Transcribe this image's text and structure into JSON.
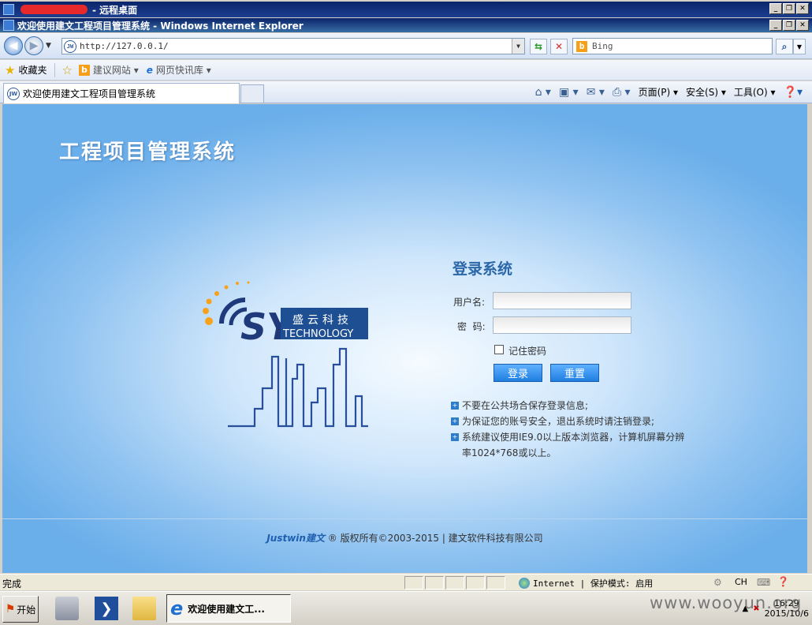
{
  "remote_window": {
    "title": "- 远程桌面"
  },
  "ie_window": {
    "title": "欢迎使用建文工程项目管理系统 - Windows Internet Explorer"
  },
  "address_bar": {
    "url": "http://127.0.0.1/",
    "search_placeholder": "Bing"
  },
  "favorites_bar": {
    "favorites_label": "收藏夹",
    "items": [
      "建议网站 ▾",
      "网页快讯库 ▾"
    ]
  },
  "tab": {
    "label": "欢迎使用建文工程项目管理系统"
  },
  "command_bar": {
    "page": "页面(P) ▾",
    "safety": "安全(S) ▾",
    "tools": "工具(O) ▾"
  },
  "page": {
    "system_title": "工程项目管理系统",
    "logo": {
      "company_cn": "盛云科技",
      "company_en": "TECHNOLOGY",
      "mark": "SY"
    },
    "login": {
      "title": "登录系统",
      "username_label": "用户名:",
      "password_label": "密  码:",
      "remember_label": "记住密码",
      "login_button": "登录",
      "reset_button": "重置"
    },
    "tips": [
      "不要在公共场合保存登录信息;",
      "为保证您的账号安全，退出系统时请注销登录;",
      "系统建议使用IE9.0以上版本浏览器，计算机屏幕分辨",
      "率1024*768或以上。"
    ],
    "footer": {
      "brand": "Justwin建文",
      "text": "® 版权所有©2003-2015 | 建文软件科技有限公司"
    }
  },
  "status_bar": {
    "status": "完成",
    "zone": "Internet | 保护模式: 启用",
    "lang": "CH"
  },
  "taskbar": {
    "start": "开始",
    "active_task": "欢迎使用建文工...",
    "time": "16:29",
    "date": "2015/10/6"
  },
  "watermark": "www.wooyun.org",
  "colors": {
    "accent": "#2b67a8",
    "button": "#1f7fe0",
    "title_bar": "#0a246a"
  }
}
